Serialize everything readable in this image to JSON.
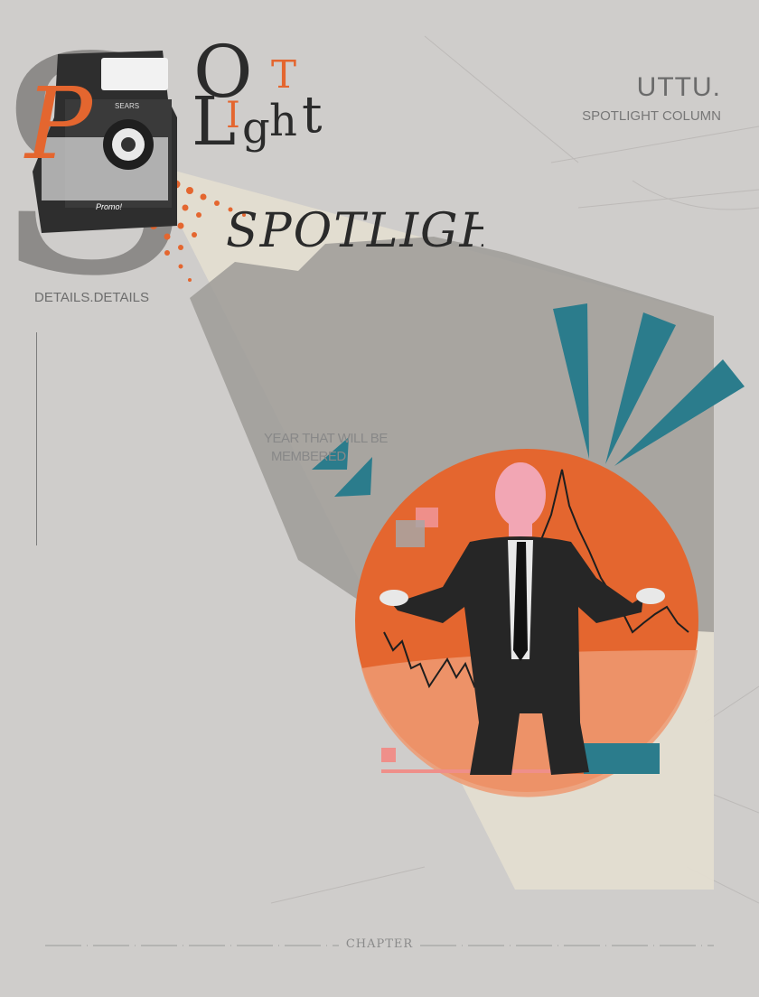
{
  "header": {
    "brand": "UTTU.",
    "column": "SPOTLIGHT COLUMN"
  },
  "logo": {
    "letters": [
      "P",
      "O",
      "T",
      "L",
      "I",
      "g",
      "h",
      "t"
    ],
    "camera_brand": "SEARS",
    "camera_model": "Promo!"
  },
  "details_label": "DETAILS.DETAILS",
  "spotlight_title": "SPOTLIGHT",
  "tagline_lines": [
    "YEAR THAT WILL BE",
    "MEMBERED"
  ],
  "footer": {
    "chapter": "CHAPTER"
  },
  "colors": {
    "background": "#cfcdcb",
    "accent_orange": "#e4662f",
    "accent_teal": "#2b7c8c",
    "pink": "#ef8f8a",
    "ink": "#2b2b2b"
  }
}
